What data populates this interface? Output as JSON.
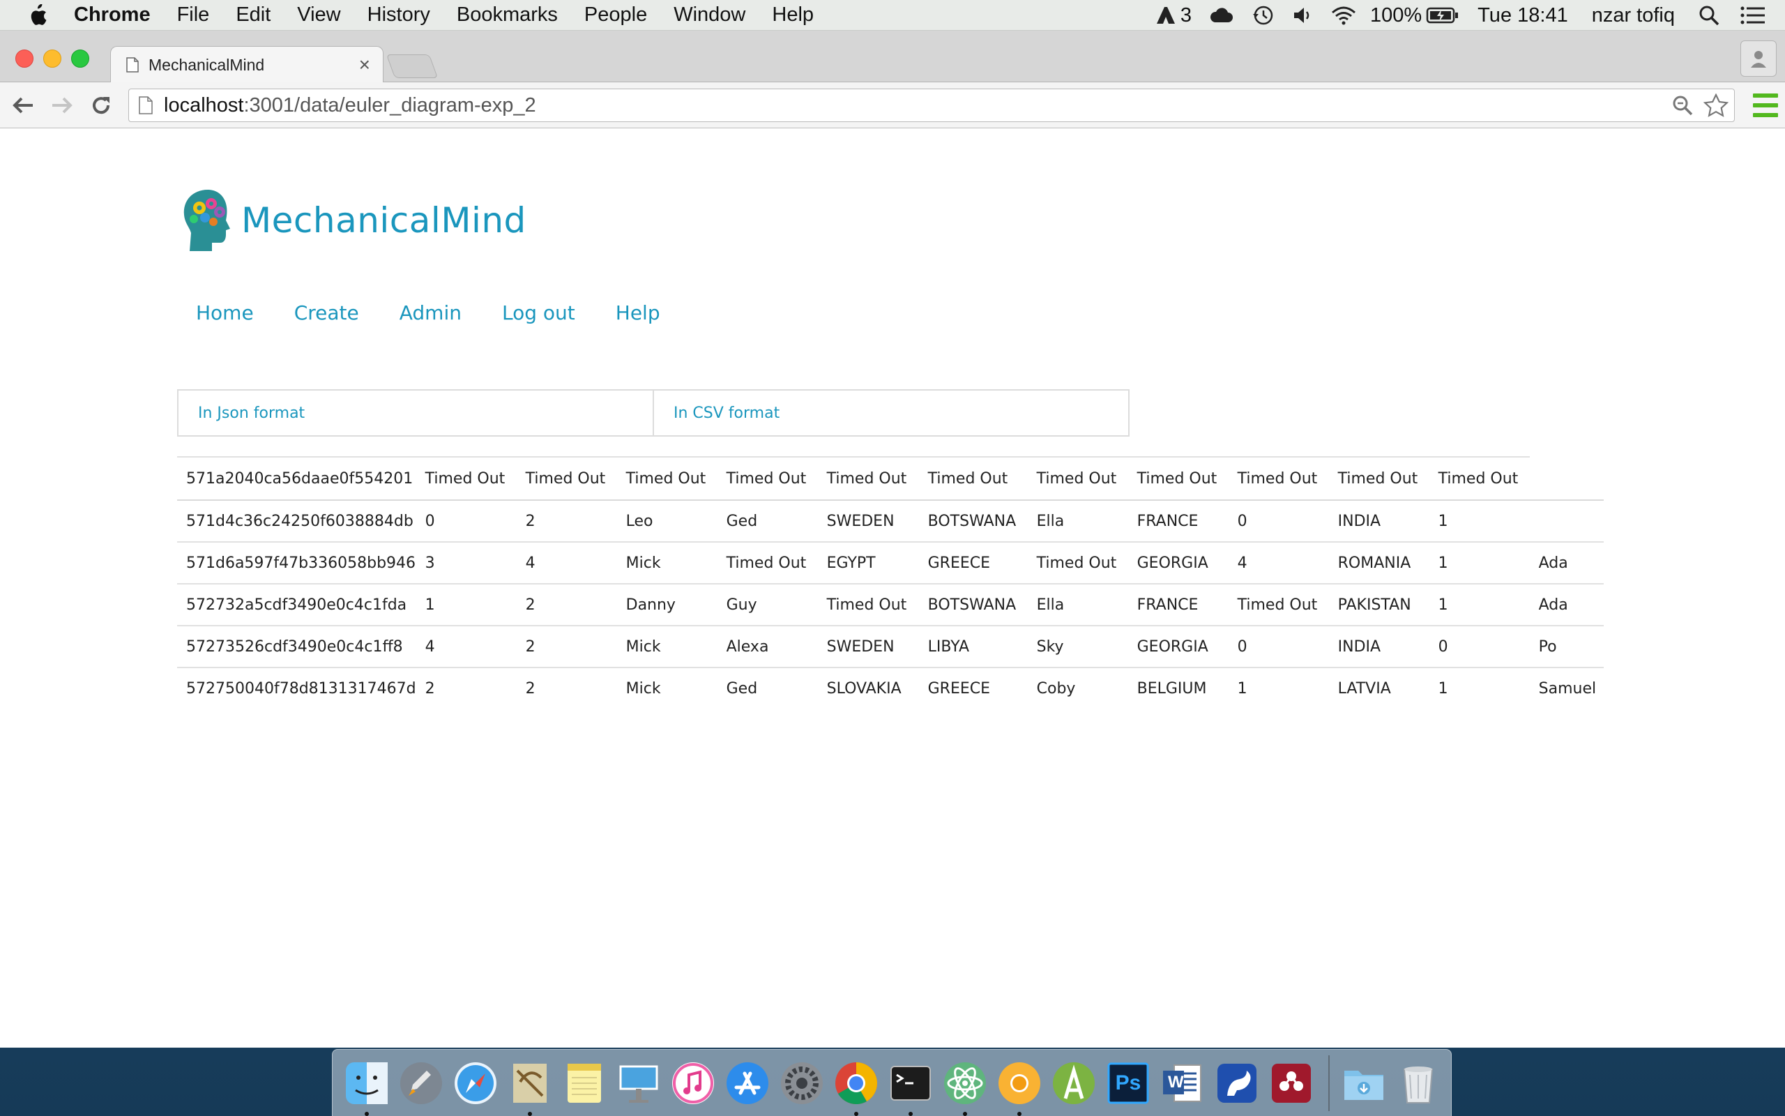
{
  "menubar": {
    "app_name": "Chrome",
    "menus": [
      "File",
      "Edit",
      "View",
      "History",
      "Bookmarks",
      "People",
      "Window",
      "Help"
    ],
    "adobe_count": "3",
    "battery": "100%",
    "clock": "Tue 18:41",
    "user": "nzar tofiq"
  },
  "browser": {
    "tab_title": "MechanicalMind",
    "tab_close": "×",
    "url_host": "localhost",
    "url_path": ":3001/data/euler_diagram-exp_2"
  },
  "site": {
    "brand": "MechanicalMind",
    "nav": [
      "Home",
      "Create",
      "Admin",
      "Log out",
      "Help"
    ],
    "format_tabs": [
      "In Json format",
      "In CSV format"
    ]
  },
  "table": {
    "rows": [
      [
        "571a2040ca56daae0f554201",
        "Timed Out",
        "Timed Out",
        "Timed Out",
        "Timed Out",
        "Timed Out",
        "Timed Out",
        "Timed Out",
        "Timed Out",
        "Timed Out",
        "Timed Out",
        "Timed Out",
        ""
      ],
      [
        "571d4c36c24250f6038884db",
        "0",
        "2",
        "Leo",
        "Ged",
        "SWEDEN",
        "BOTSWANA",
        "Ella",
        "FRANCE",
        "0",
        "INDIA",
        "1",
        ""
      ],
      [
        "571d6a597f47b336058bb946",
        "3",
        "4",
        "Mick",
        "Timed Out",
        "EGYPT",
        "GREECE",
        "Timed Out",
        "GEORGIA",
        "4",
        "ROMANIA",
        "1",
        "Ada"
      ],
      [
        "572732a5cdf3490e0c4c1fda",
        "1",
        "2",
        "Danny",
        "Guy",
        "Timed Out",
        "BOTSWANA",
        "Ella",
        "FRANCE",
        "Timed Out",
        "PAKISTAN",
        "1",
        "Ada"
      ],
      [
        "57273526cdf3490e0c4c1ff8",
        "4",
        "2",
        "Mick",
        "Alexa",
        "SWEDEN",
        "LIBYA",
        "Sky",
        "GEORGIA",
        "0",
        "INDIA",
        "0",
        "Po"
      ],
      [
        "572750040f78d8131317467d",
        "2",
        "2",
        "Mick",
        "Ged",
        "SLOVAKIA",
        "GREECE",
        "Coby",
        "BELGIUM",
        "1",
        "LATVIA",
        "1",
        "Samuel"
      ]
    ]
  },
  "dock": {
    "apps": [
      "finder-icon",
      "launchpad-icon",
      "safari-icon",
      "mail-icon",
      "notes-icon",
      "keynote-icon",
      "itunes-icon",
      "app-store-icon",
      "system-preferences-icon",
      "chrome-icon",
      "terminal-icon",
      "atom-icon",
      "chrome-canary-icon",
      "android-studio-icon",
      "photoshop-icon",
      "word-icon",
      "squirrel-icon",
      "mendeley-icon",
      "downloads-folder-icon",
      "trash-icon"
    ],
    "photoshop_label": "Ps",
    "word_label": "W"
  },
  "colors": {
    "brand": "#1a96bd",
    "menubar": "#e8ebe8"
  }
}
